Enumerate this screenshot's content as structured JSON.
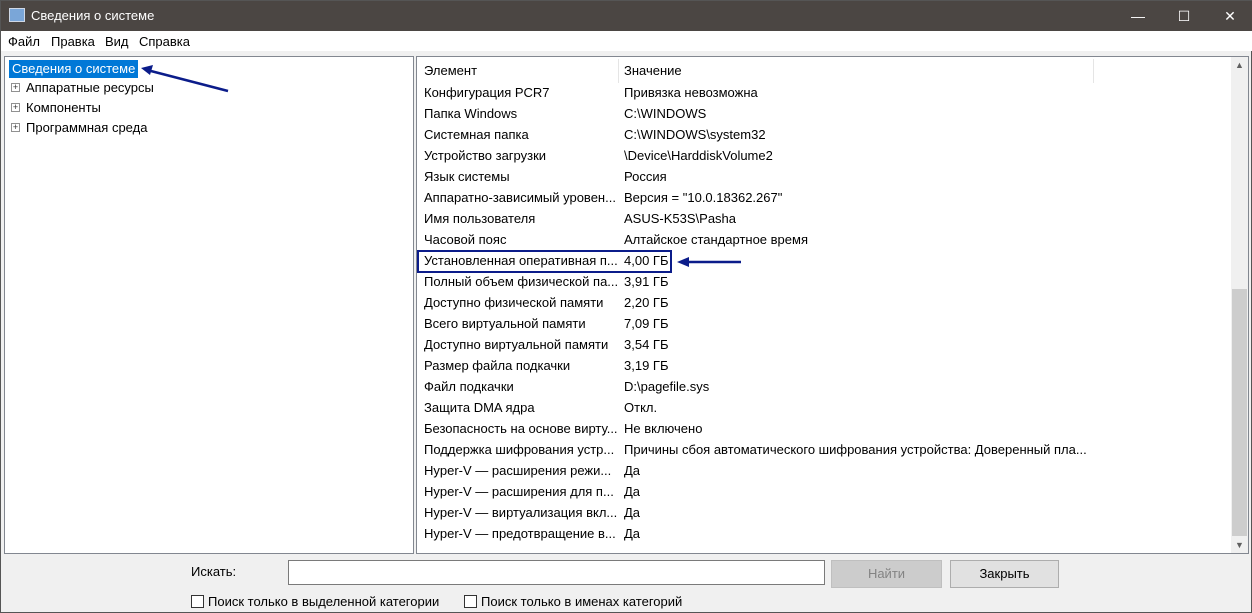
{
  "window": {
    "title": "Сведения о системе",
    "minimize": "—",
    "maximize": "☐",
    "close": "✕"
  },
  "menu": [
    "Файл",
    "Правка",
    "Вид",
    "Справка"
  ],
  "tree": {
    "root": "Сведения о системе",
    "children": [
      "Аппаратные ресурсы",
      "Компоненты",
      "Программная среда"
    ]
  },
  "table": {
    "headers": [
      "Элемент",
      "Значение"
    ],
    "rows": [
      [
        "Конфигурация PCR7",
        "Привязка невозможна"
      ],
      [
        "Папка Windows",
        "C:\\WINDOWS"
      ],
      [
        "Системная папка",
        "C:\\WINDOWS\\system32"
      ],
      [
        "Устройство загрузки",
        "\\Device\\HarddiskVolume2"
      ],
      [
        "Язык системы",
        "Россия"
      ],
      [
        "Аппаратно-зависимый уровен...",
        "Версия = \"10.0.18362.267\""
      ],
      [
        "Имя пользователя",
        "ASUS-K53S\\Pasha"
      ],
      [
        "Часовой пояс",
        "Алтайское стандартное время"
      ],
      [
        "Установленная оперативная п...",
        "4,00 ГБ"
      ],
      [
        "Полный объем физической па...",
        "3,91 ГБ"
      ],
      [
        "Доступно физической памяти",
        "2,20 ГБ"
      ],
      [
        "Всего виртуальной памяти",
        "7,09 ГБ"
      ],
      [
        "Доступно виртуальной памяти",
        "3,54 ГБ"
      ],
      [
        "Размер файла подкачки",
        "3,19 ГБ"
      ],
      [
        "Файл подкачки",
        "D:\\pagefile.sys"
      ],
      [
        "Защита DMA ядра",
        "Откл."
      ],
      [
        "Безопасность на основе вирту...",
        "Не включено"
      ],
      [
        "Поддержка шифрования устр...",
        "Причины сбоя автоматического шифрования устройства: Доверенный пла..."
      ],
      [
        "Hyper-V — расширения режи...",
        "Да"
      ],
      [
        "Hyper-V — расширения для п...",
        "Да"
      ],
      [
        "Hyper-V — виртуализация вкл...",
        "Да"
      ],
      [
        "Hyper-V — предотвращение в...",
        "Да"
      ]
    ]
  },
  "bottom": {
    "search_label": "Искать:",
    "search_value": "",
    "find": "Найти",
    "close": "Закрыть",
    "chk1": "Поиск только в выделенной категории",
    "chk2": "Поиск только в именах категорий"
  },
  "colors": {
    "annotation": "#0b1c8a",
    "selection": "#0078d7"
  }
}
